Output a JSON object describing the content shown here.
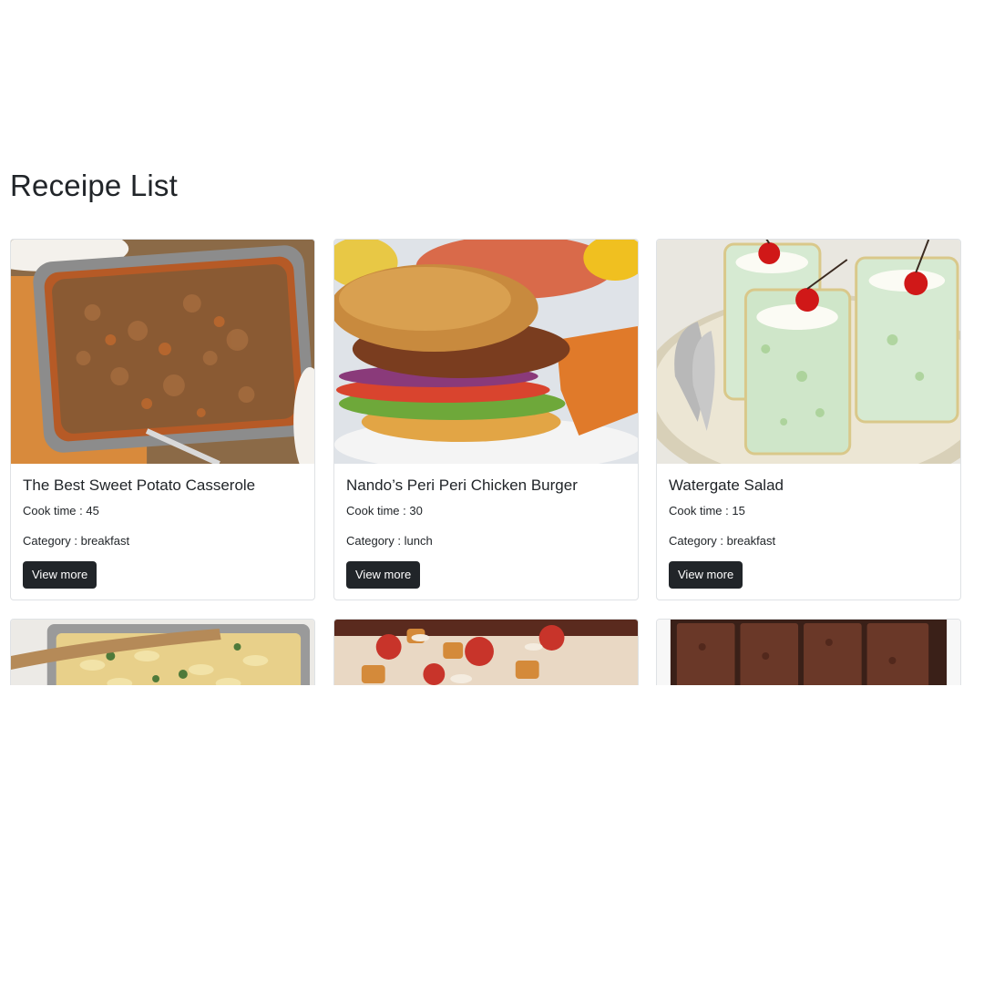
{
  "page": {
    "title": "Receipe List"
  },
  "labels": {
    "cook_prefix": "Cook time : ",
    "category_prefix": "Category : "
  },
  "recipes": [
    {
      "title": "The Best Sweet Potato Casserole",
      "cook_time": "45",
      "category": "breakfast",
      "button": "View more",
      "image": "sweet-potato-casserole-image"
    },
    {
      "title": "Nando’s Peri Peri Chicken Burger",
      "cook_time": "30",
      "category": "lunch",
      "button": "View more",
      "image": "chicken-burger-image"
    },
    {
      "title": "Watergate Salad",
      "cook_time": "15",
      "category": "breakfast",
      "button": "View more",
      "image": "watergate-salad-image"
    },
    {
      "image": "pasta-bake-image"
    },
    {
      "image": "roasted-vegetables-image"
    },
    {
      "image": "brownies-image"
    }
  ],
  "colors": {
    "button_bg": "#212529",
    "text": "#212529",
    "card_border": "#dfe2e5"
  }
}
